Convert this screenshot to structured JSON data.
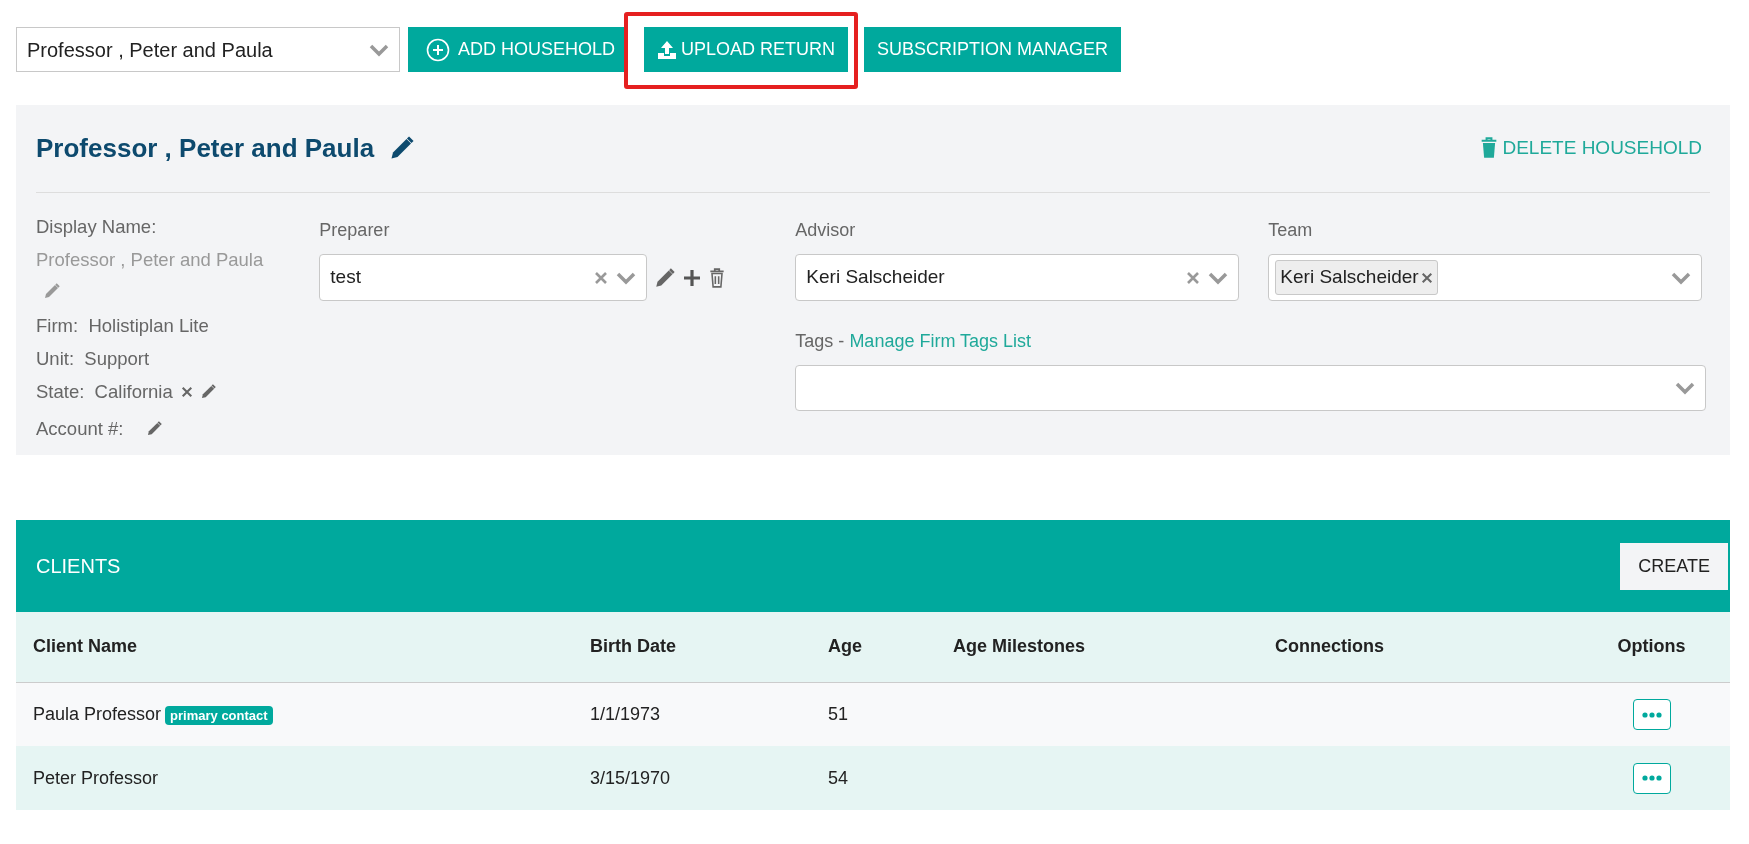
{
  "household_select": {
    "value": "Professor , Peter and Paula"
  },
  "toolbar_buttons": [
    {
      "kind": "add",
      "label": "ADD HOUSEHOLD",
      "highlighted": false
    },
    {
      "kind": "upload",
      "label": "UPLOAD RETURN",
      "highlighted": true
    },
    {
      "kind": "plain",
      "label": "SUBSCRIPTION MANAGER",
      "highlighted": false
    }
  ],
  "household": {
    "title": "Professor , Peter and Paula",
    "delete_label": "DELETE HOUSEHOLD",
    "details": [
      {
        "kind": "display_name",
        "label": "Display Name:",
        "value": "Professor , Peter and Paula"
      },
      {
        "kind": "plain",
        "label": "Firm:",
        "value": "Holistiplan Lite"
      },
      {
        "kind": "plain",
        "label": "Unit:",
        "value": "Support"
      },
      {
        "kind": "state",
        "label": "State:",
        "value": "California"
      },
      {
        "kind": "account",
        "label": "Account #:"
      }
    ],
    "preparer": {
      "label": "Preparer",
      "value": "test"
    },
    "advisor": {
      "label": "Advisor",
      "value": "Keri Salscheider"
    },
    "team": {
      "label": "Team",
      "tags": [
        "Keri Salscheider"
      ]
    },
    "tags": {
      "label": "Tags - ",
      "link": "Manage Firm Tags List"
    }
  },
  "clients": {
    "title": "CLIENTS",
    "create_label": "CREATE",
    "columns": [
      "Client Name",
      "Birth Date",
      "Age",
      "Age Milestones",
      "Connections",
      "Options"
    ],
    "rows": [
      {
        "name": "Paula Professor",
        "badge": "primary contact",
        "birth_date": "1/1/1973",
        "age": "51"
      },
      {
        "name": "Peter Professor",
        "birth_date": "3/15/1970",
        "age": "54"
      }
    ]
  }
}
